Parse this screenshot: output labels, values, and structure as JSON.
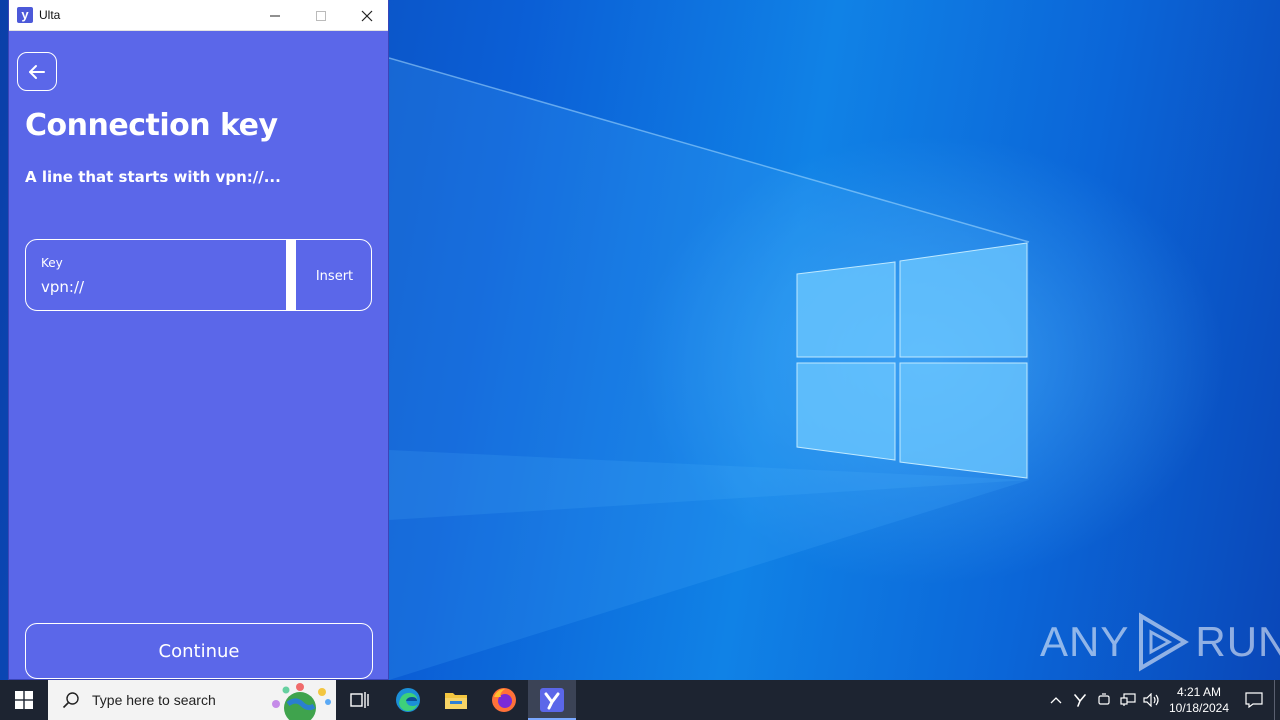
{
  "window": {
    "title": "Ulta",
    "app_icon_glyph": "y"
  },
  "screen": {
    "heading": "Connection key",
    "subheading": "A line that starts with vpn://...",
    "key_field": {
      "label": "Key",
      "value": "vpn://"
    },
    "insert_label": "Insert",
    "continue_label": "Continue"
  },
  "taskbar": {
    "search_placeholder": "Type here to search",
    "pinned": [
      "task-view-icon",
      "edge-icon",
      "file-explorer-icon",
      "firefox-icon",
      "ulta-icon"
    ],
    "clock_time": "4:21 AM",
    "clock_date": "10/18/2024"
  },
  "watermark": {
    "left": "ANY",
    "right": "RUN"
  },
  "colors": {
    "app_background": "#5b67e9",
    "taskbar": "#1d2431",
    "accent": "#4c59d9"
  }
}
